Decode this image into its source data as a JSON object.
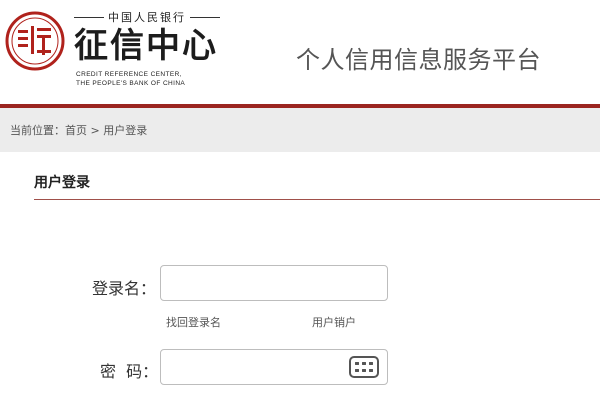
{
  "header": {
    "logo_top": "中国人民银行",
    "logo_title": "征信中心",
    "logo_en_line1": "CREDIT REFERENCE CENTER,",
    "logo_en_line2": "THE PEOPLE'S BANK OF CHINA",
    "platform_title": "个人信用信息服务平台",
    "brand_color": "#9b2520"
  },
  "breadcrumb": {
    "prefix": "当前位置：",
    "home": "首页",
    "separator": " > ",
    "current": "用户登录"
  },
  "login": {
    "section_title": "用户登录",
    "username_label": "登录名：",
    "username_value": "",
    "forgot_username_link": "找回登录名",
    "deregister_link": "用户销户",
    "password_label": "密  码：",
    "password_value": "",
    "keyboard_icon": "virtual-keyboard-icon"
  }
}
